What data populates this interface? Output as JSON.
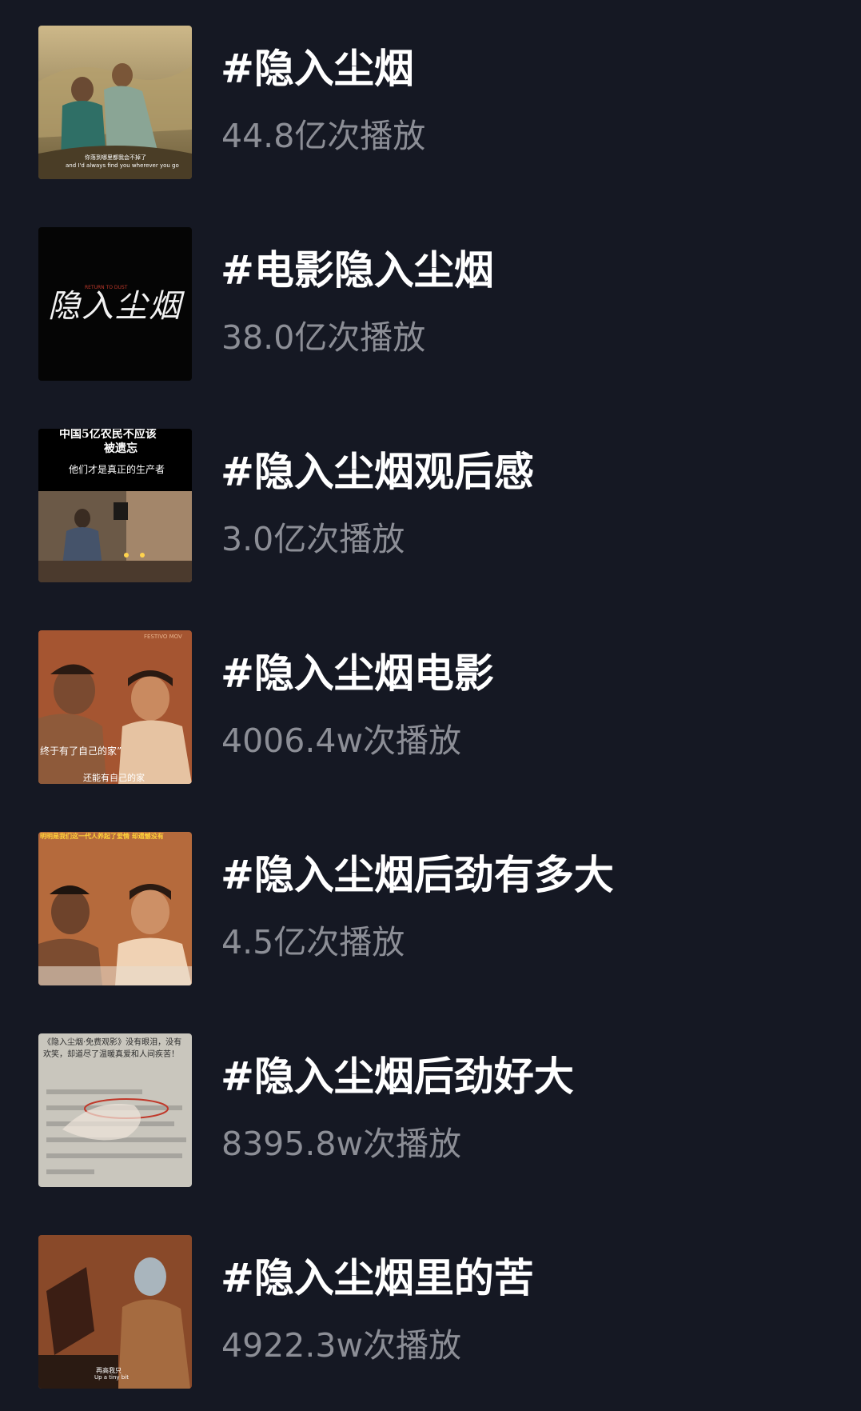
{
  "topics": [
    {
      "title": "#隐入尘烟",
      "plays": "44.8亿次播放",
      "thumb_caption_cn": "你落到哪里都我会不掉了",
      "thumb_caption_en": "and I'd always find you wherever you go"
    },
    {
      "title": "#电影隐入尘烟",
      "plays": "38.0亿次播放",
      "thumb_title_cn": "隐入尘烟",
      "thumb_title_en": "RETURN TO DUST"
    },
    {
      "title": "#隐入尘烟观后感",
      "plays": "3.0亿次播放",
      "thumb_line1": "中国5亿农民不应该",
      "thumb_line2": "被遗忘",
      "thumb_line3": "他们才是真正的生产者"
    },
    {
      "title": "#隐入尘烟电影",
      "plays": "4006.4w次播放",
      "thumb_badge": "FESTIVO MOV",
      "thumb_caption1": "终于有了自己的家”",
      "thumb_caption2": "还能有自己的家"
    },
    {
      "title": "#隐入尘烟后劲有多大",
      "plays": "4.5亿次播放",
      "thumb_banner": "明明是我们这一代人养起了爱情  却遗憾没有"
    },
    {
      "title": "#隐入尘烟后劲好大",
      "plays": "8395.8w次播放",
      "thumb_text": "《隐入尘烟·免费观影》没有眼泪，没有欢笑，却道尽了温暖真爱和人间疾苦！"
    },
    {
      "title": "#隐入尘烟里的苦",
      "plays": "4922.3w次播放",
      "thumb_caption_cn": "再高我只",
      "thumb_caption_en": "Up a tiny bit"
    }
  ],
  "colors": {
    "background": "#151823",
    "title": "#ffffff",
    "plays": "#8c8e96"
  }
}
